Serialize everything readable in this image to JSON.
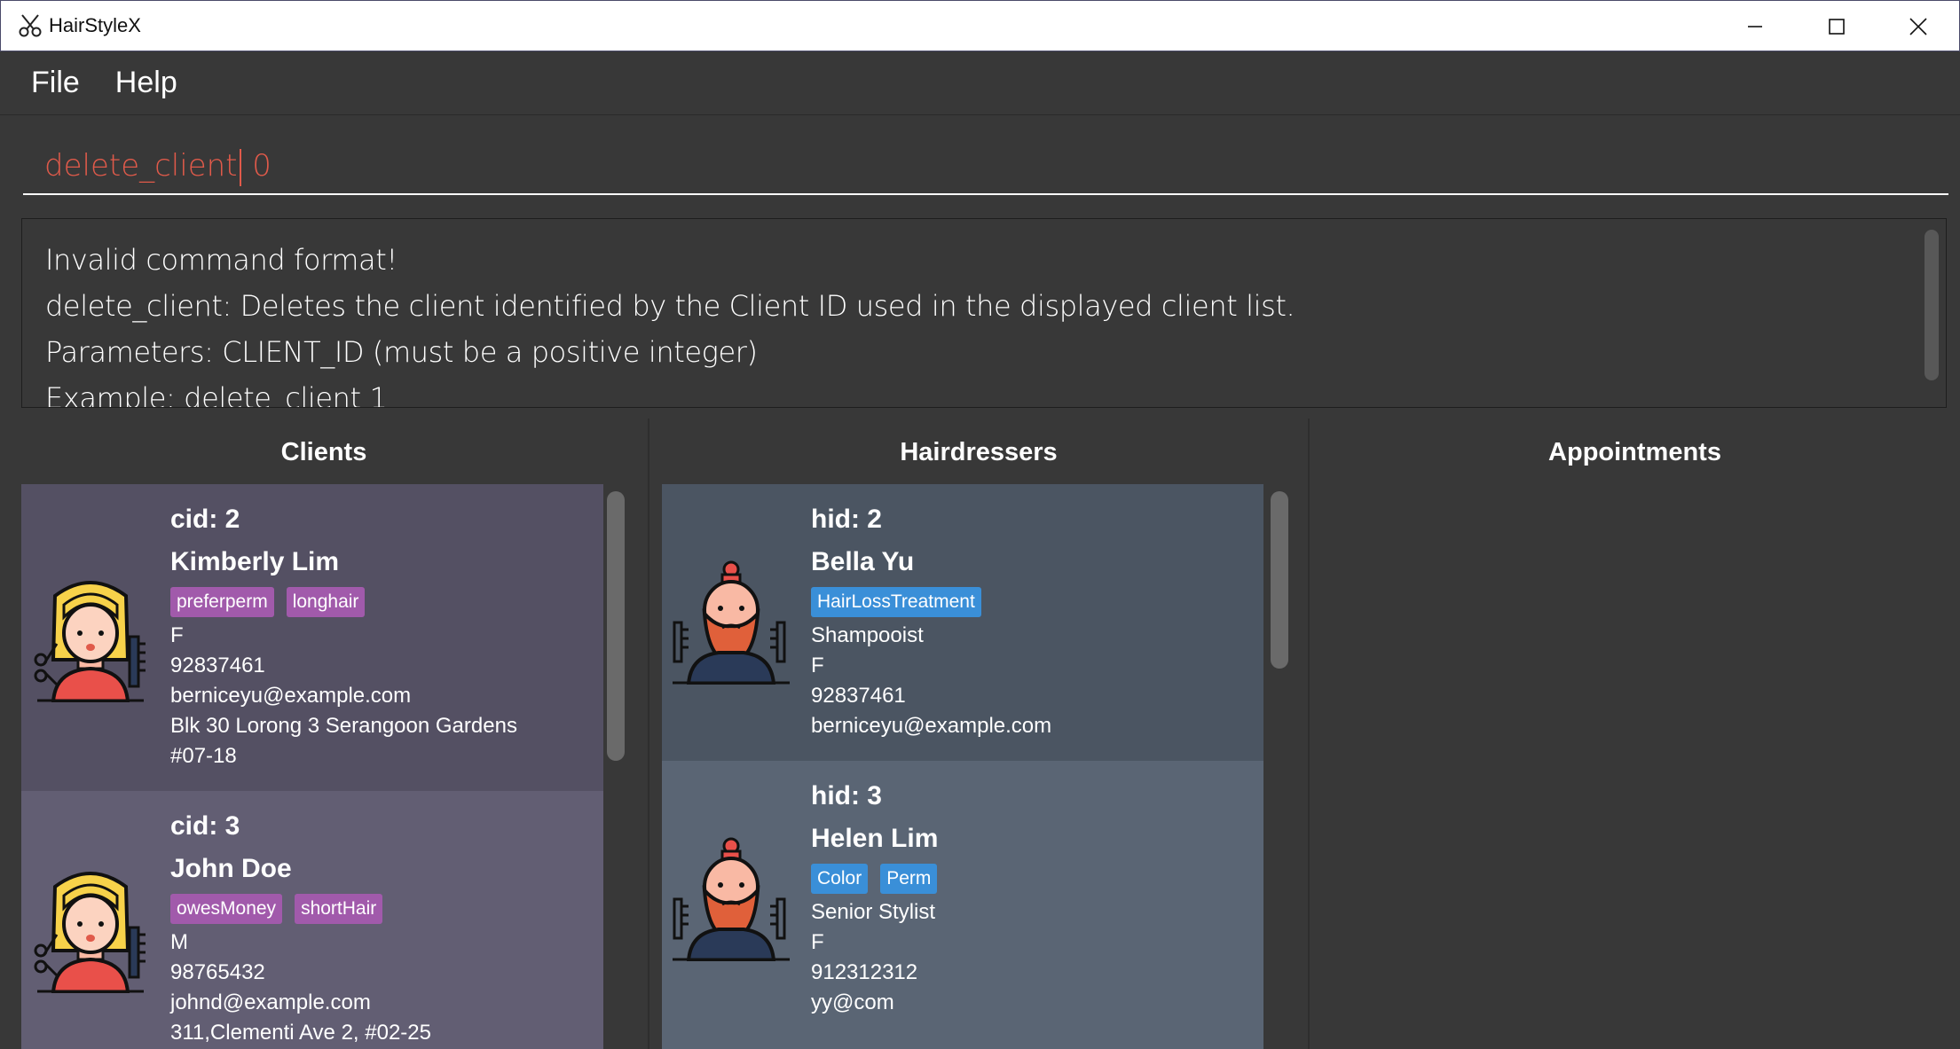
{
  "window": {
    "title": "HairStyleX"
  },
  "menu": {
    "file": "File",
    "help": "Help"
  },
  "command": {
    "value": "delete_client",
    "value_after_caret": " 0"
  },
  "result": {
    "lines": [
      "Invalid command format!",
      "delete_client: Deletes the client identified by the Client ID used in the displayed client list.",
      "Parameters: CLIENT_ID (must be a positive integer)",
      "Example: delete_client 1"
    ]
  },
  "panels": {
    "clients_title": "Clients",
    "hairdressers_title": "Hairdressers",
    "appointments_title": "Appointments"
  },
  "clients": [
    {
      "id": "cid: 2",
      "name": "Kimberly Lim",
      "tags": [
        "preferperm",
        "longhair"
      ],
      "gender": "F",
      "phone": "92837461",
      "email": "berniceyu@example.com",
      "address1": "Blk 30 Lorong 3 Serangoon Gardens",
      "address2": "#07-18"
    },
    {
      "id": "cid: 3",
      "name": "John Doe",
      "tags": [
        "owesMoney",
        "shortHair"
      ],
      "gender": "M",
      "phone": "98765432",
      "email": "johnd@example.com",
      "address1": "311,Clementi Ave 2, #02-25",
      "address2": ""
    }
  ],
  "hairdressers": [
    {
      "id": "hid: 2",
      "name": "Bella Yu",
      "tags": [
        "HairLossTreatment"
      ],
      "title": "Shampooist",
      "gender": "F",
      "phone": "92837461",
      "email": "berniceyu@example.com"
    },
    {
      "id": "hid: 3",
      "name": "Helen Lim",
      "tags": [
        "Color",
        "Perm"
      ],
      "title": "Senior Stylist",
      "gender": "F",
      "phone": "912312312",
      "email": "yy@com"
    }
  ],
  "colors": {
    "client_card_1": "#545063",
    "client_card_2": "#625e73",
    "hairdresser_card_1": "#4b5562",
    "hairdresser_card_2": "#5a6574",
    "client_tag": "#a15aab",
    "hairdresser_tag": "#3a8fd8",
    "command_text": "#e05a4a"
  },
  "icons": {
    "app": "scissors-icon",
    "client_avatar": "woman-stylist-avatar-icon",
    "hairdresser_avatar": "bearded-barber-avatar-icon"
  }
}
